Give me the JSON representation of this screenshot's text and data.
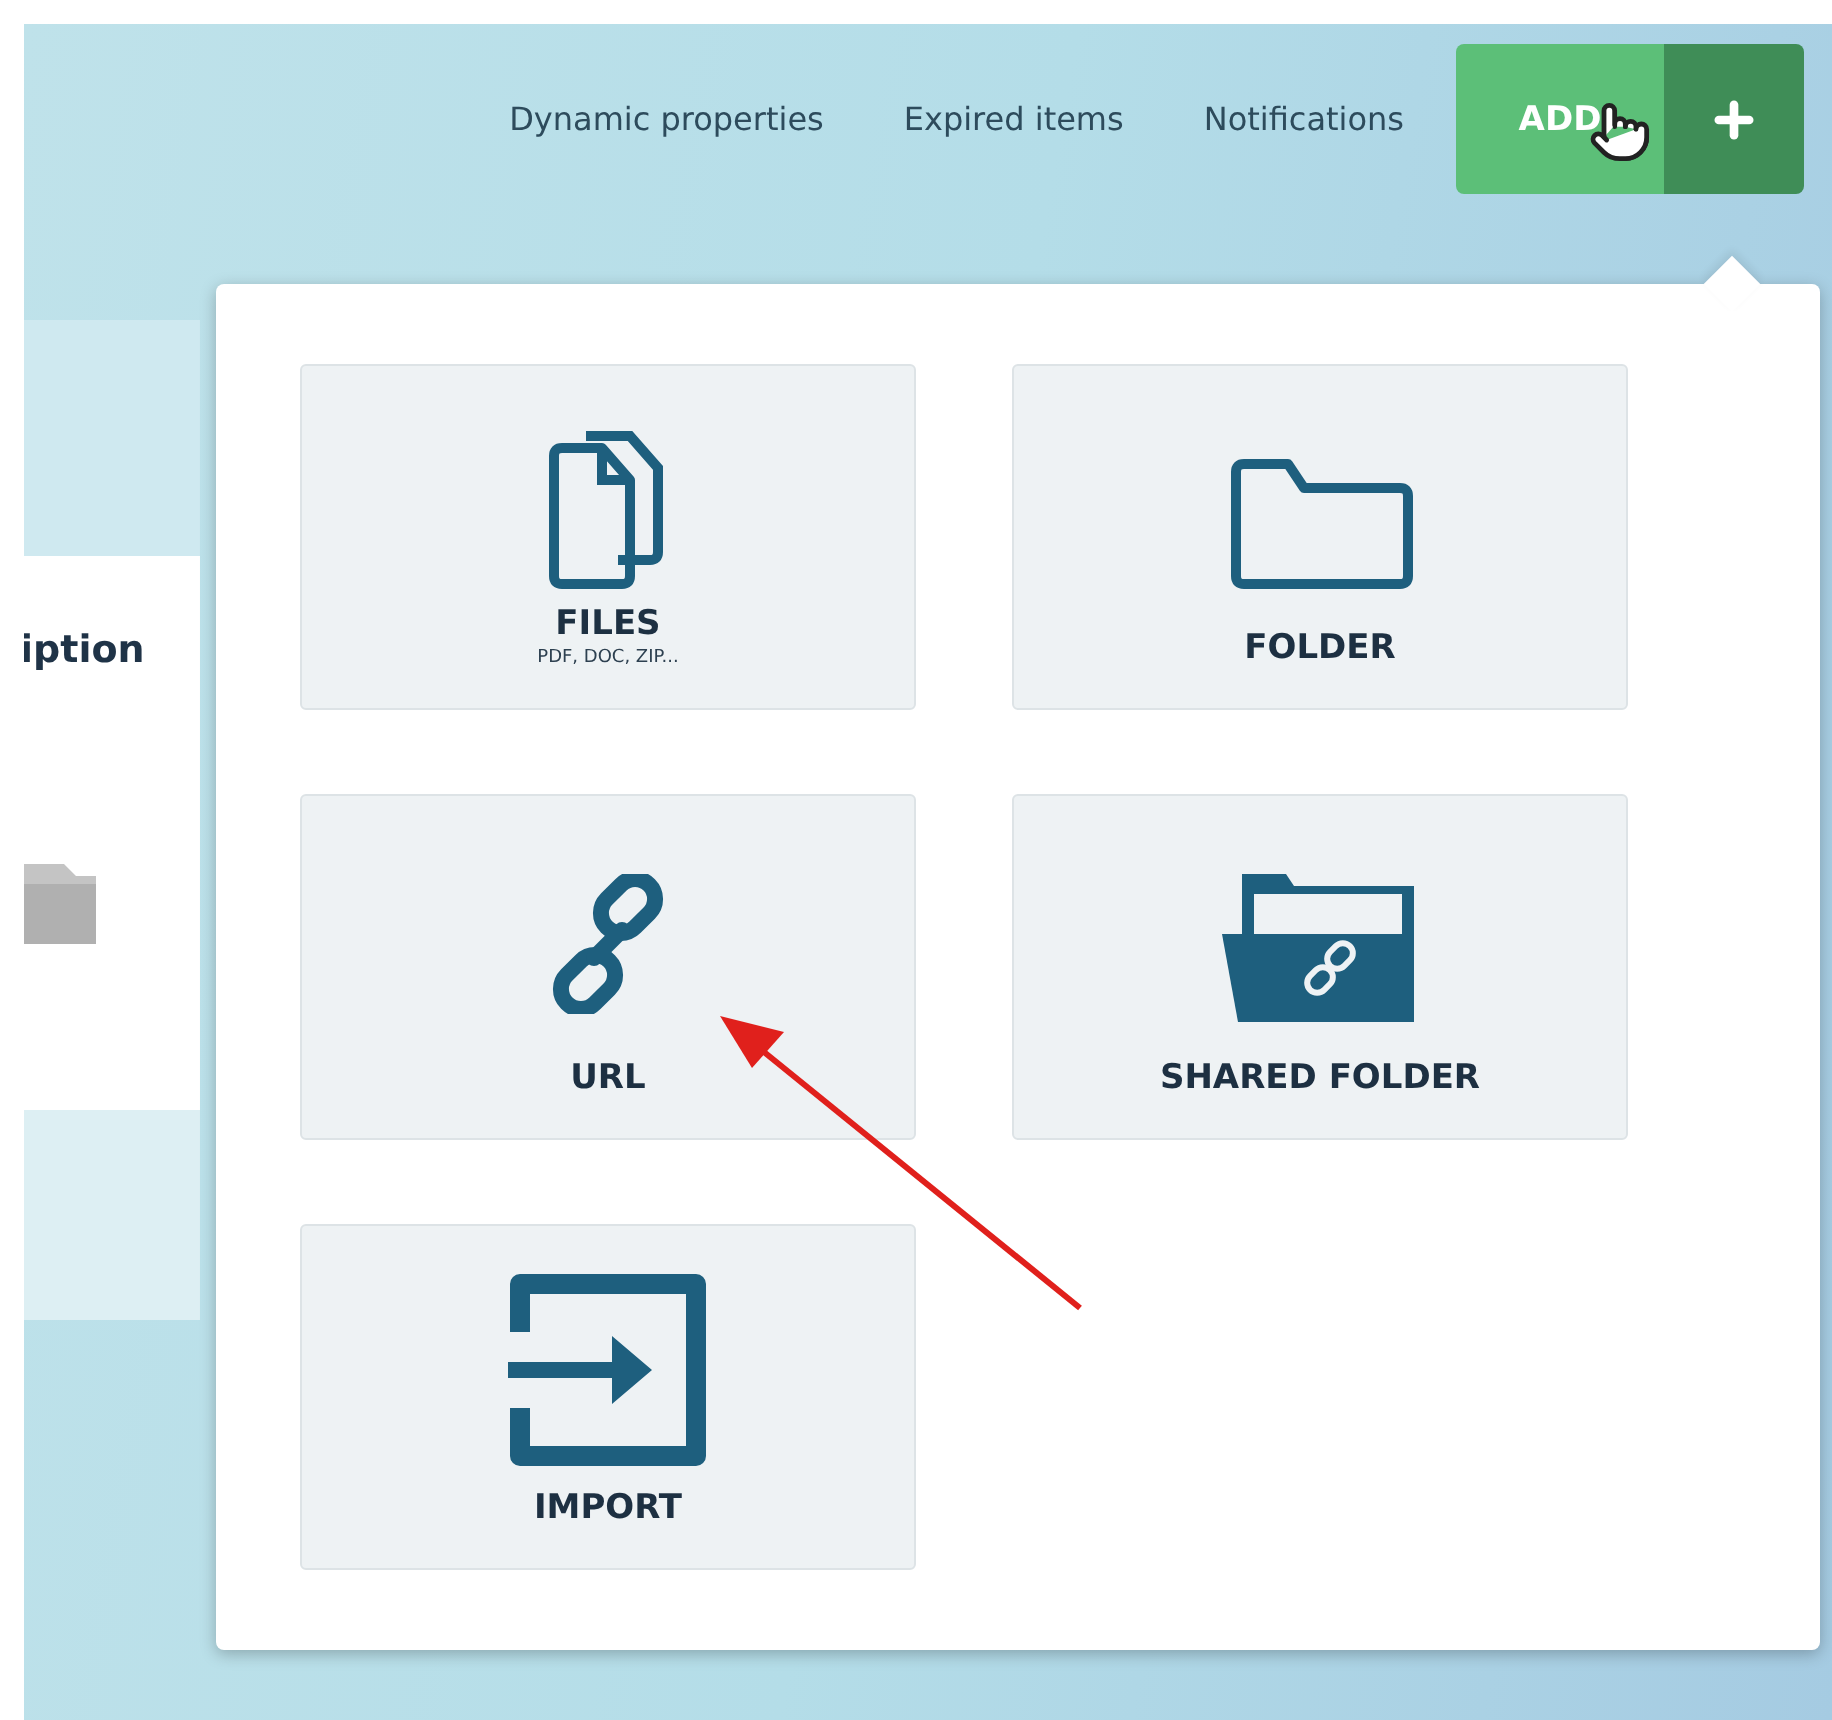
{
  "nav": [
    {
      "label": "Dynamic properties"
    },
    {
      "label": "Expired items"
    },
    {
      "label": "Notifications"
    }
  ],
  "add_button": {
    "label": "ADD"
  },
  "background_panel": {
    "heading": "iption"
  },
  "menu": {
    "items": [
      {
        "kind": "files",
        "label": "FILES",
        "sublabel": "PDF, DOC, ZIP..."
      },
      {
        "kind": "folder",
        "label": "FOLDER"
      },
      {
        "kind": "url",
        "label": "URL"
      },
      {
        "kind": "shared_folder",
        "label": "SHARED FOLDER"
      },
      {
        "kind": "import",
        "label": "IMPORT"
      }
    ]
  }
}
